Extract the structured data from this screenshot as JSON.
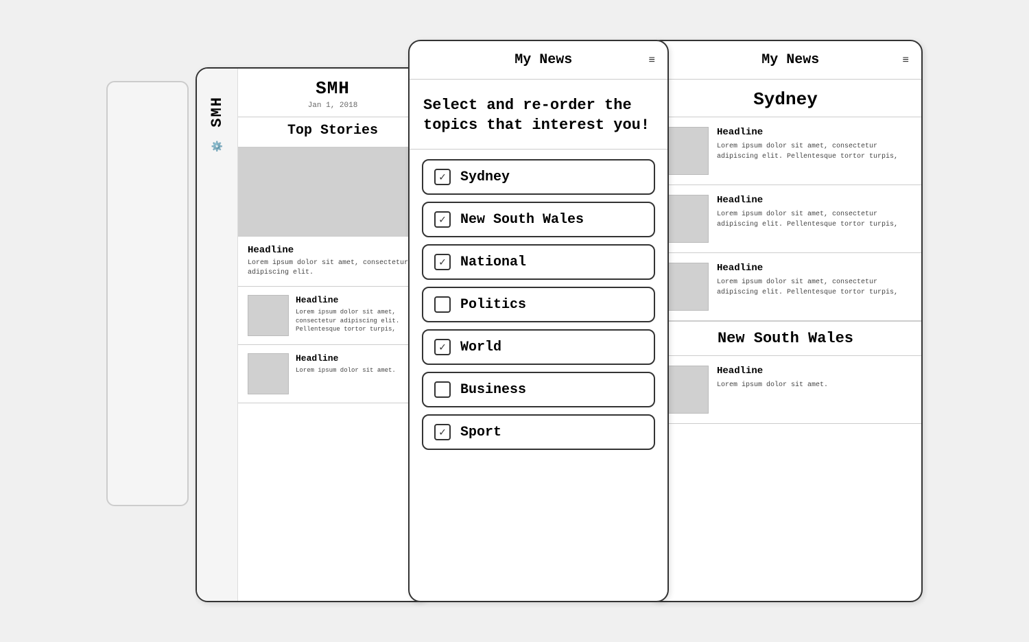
{
  "scene": {
    "phone1": {
      "logo": "SMH",
      "date": "Jan 1, 2018",
      "sectionTitle": "Top Stories",
      "articles": [
        {
          "headline": "Headline",
          "body": "Lorem ipsum dolor sit amet, consectetur\nadipiscing elit."
        }
      ],
      "articlesWithThumb": [
        {
          "headline": "Headline",
          "body": "Lorem ipsum dolor sit amet,\nconsectetur adipiscing elit.\nPellentesque tortor turpis,"
        },
        {
          "headline": "Headline",
          "body": "Lorem ipsum dolor sit amet."
        }
      ]
    },
    "phone2": {
      "title": "My News",
      "hamburgerLabel": "≡",
      "intro": "Select and re-order the topics that interest you!",
      "topics": [
        {
          "label": "Sydney",
          "checked": true
        },
        {
          "label": "New South Wales",
          "checked": true
        },
        {
          "label": "National",
          "checked": true
        },
        {
          "label": "Politics",
          "checked": false
        },
        {
          "label": "World",
          "checked": true
        },
        {
          "label": "Business",
          "checked": false
        },
        {
          "label": "Sport",
          "checked": true
        }
      ]
    },
    "phone3": {
      "title": "My News",
      "hamburgerLabel": "≡",
      "sections": [
        {
          "heading": "Sydney",
          "articles": [
            {
              "headline": "Headline",
              "body": "Lorem ipsum dolor sit amet,\nconsectetur adipiscing elit.\nPellentesque tortor turpis,"
            },
            {
              "headline": "Headline",
              "body": "Lorem ipsum dolor sit amet,\nconsectetur adipiscing elit.\nPellentesque tortor turpis,"
            },
            {
              "headline": "Headline",
              "body": "Lorem ipsum dolor sit amet,\nconsectetur adipiscing elit.\nPellentesque tortor turpis,"
            }
          ]
        },
        {
          "heading": "New South Wales",
          "articles": [
            {
              "headline": "Headline",
              "body": "Lorem ipsum dolor sit amet."
            }
          ]
        }
      ]
    }
  }
}
